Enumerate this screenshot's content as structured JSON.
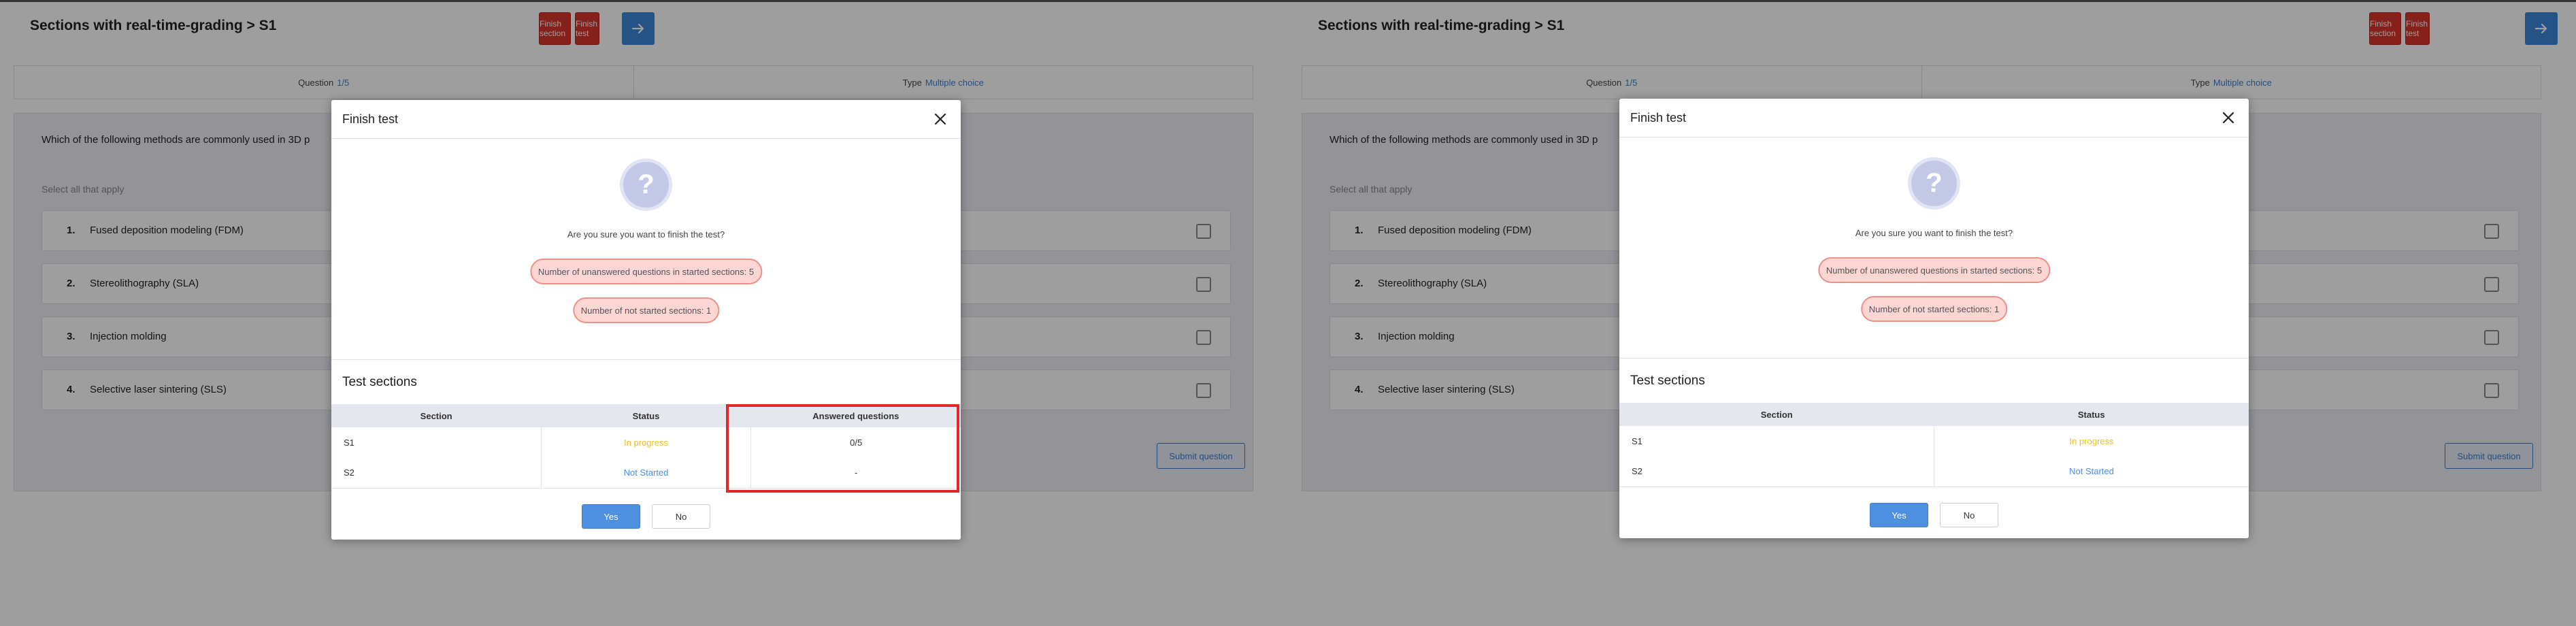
{
  "page": {
    "title": "Sections with real-time-grading > S1",
    "finish_section_label": "Finish section",
    "finish_test_label": "Finish test"
  },
  "info": {
    "question_label": "Question",
    "question_value": "1/5",
    "type_label": "Type",
    "type_value": "Multiple choice"
  },
  "question": {
    "text": "Which of the following methods are commonly used in 3D p",
    "select_hint": "Select all that apply",
    "options": [
      {
        "num": "1.",
        "label": "Fused deposition modeling (FDM)"
      },
      {
        "num": "2.",
        "label": "Stereolithography (SLA)"
      },
      {
        "num": "3.",
        "label": "Injection molding"
      },
      {
        "num": "4.",
        "label": "Selective laser sintering (SLS)"
      }
    ],
    "submit_label": "Submit question"
  },
  "modal": {
    "title": "Finish test",
    "icon_glyph": "?",
    "confirm_text": "Are you sure you want to finish the test?",
    "unanswered_text": "Number of unanswered questions in started sections: 5",
    "not_started_text": "Number of not started sections: 1",
    "sections_title": "Test sections",
    "columns": {
      "section": "Section",
      "status": "Status",
      "answered": "Answered questions"
    },
    "rows": [
      {
        "section": "S1",
        "status": "In progress",
        "answered": "0/5"
      },
      {
        "section": "S2",
        "status": "Not Started",
        "answered": "-"
      }
    ],
    "yes_label": "Yes",
    "no_label": "No"
  },
  "colors": {
    "accent": "#3a7fd2",
    "danger": "#d9342b",
    "in_progress": "#e8c020",
    "not_started": "#4a8de0",
    "highlight": "#e0282b"
  }
}
